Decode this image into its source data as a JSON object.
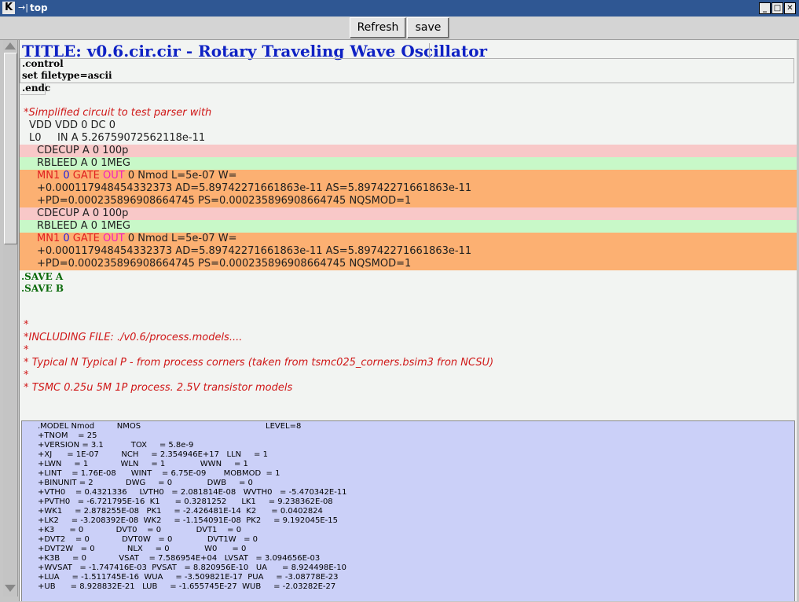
{
  "window": {
    "app_icon": "K",
    "title": "top",
    "pin_glyph": "→|",
    "minimize": "_",
    "maximize": "□",
    "close": "✕"
  },
  "toolbar": {
    "refresh_label": "Refresh",
    "save_label": "save"
  },
  "doc": {
    "title": "TITLE: v0.6.cir.cir - Rotary Traveling Wave Oscillator",
    "control": [
      ".control",
      "set filetype=ascii",
      ".endc"
    ],
    "comment1": "*Simplified circuit to test parser with",
    "vdd": "VDD VDD 0 DC 0",
    "l0_name": "L0",
    "l0_rest": "IN A 5.26759072562118e-11",
    "blocks": [
      {
        "cdecup": "CDECUP A 0 100p",
        "rbleed": "RBLEED A 0 1MEG",
        "mn1": {
          "name": "MN1",
          "n0": "0",
          "gate": "GATE",
          "out": "OUT",
          "rest": "0 Nmod L=5e-07 W="
        },
        "cont1": "+0.000117948454332373 AD=5.89742271661863e-11 AS=5.89742271661863e-11",
        "cont2": "+PD=0.000235896908664745 PS=0.000235896908664745 NQSMOD=1"
      },
      {
        "cdecup": "CDECUP A 0 100p",
        "rbleed": "RBLEED A 0 1MEG",
        "mn1": {
          "name": "MN1",
          "n0": "0",
          "gate": "GATE",
          "out": "OUT",
          "rest": "0 Nmod L=5e-07 W="
        },
        "cont1": "+0.000117948454332373 AD=5.89742271661863e-11 AS=5.89742271661863e-11",
        "cont2": "+PD=0.000235896908664745 PS=0.000235896908664745 NQSMOD=1"
      }
    ],
    "saves": [
      ".SAVE A",
      ".SAVE B"
    ],
    "include_comments": [
      "*",
      "*INCLUDING FILE: ./v0.6/process.models....",
      "*",
      "* Typical N Typical P    - from process corners  (taken from tsmc025_corners.bsim3 fron NCSU)",
      "*",
      "* TSMC 0.25u 5M 1P process.  2.5V transistor models"
    ],
    "model_lines": [
      ".MODEL Nmod         NMOS                                                  LEVEL=8",
      "+TNOM    = 25",
      "+VERSION = 3.1           TOX     = 5.8e-9",
      "+XJ      = 1E-07         NCH     = 2.354946E+17   LLN     = 1",
      "+LWN     = 1             WLN     = 1              WWN     = 1",
      "+LINT    = 1.76E-08      WINT    = 6.75E-09       MOBMOD  = 1",
      "+BINUNIT = 2             DWG     = 0              DWB     = 0",
      "+VTH0    = 0.4321336     LVTH0   = 2.081814E-08   WVTH0   = -5.470342E-11",
      "+PVTH0   = -6.721795E-16  K1      = 0.3281252      LK1     = 9.238362E-08",
      "+WK1     = 2.878255E-08   PK1     = -2.426481E-14  K2      = 0.0402824",
      "+LK2     = -3.208392E-08  WK2     = -1.154091E-08  PK2     = 9.192045E-15",
      "+K3      = 0             DVT0    = 0              DVT1    = 0",
      "+DVT2    = 0             DVT0W   = 0              DVT1W   = 0",
      "+DVT2W   = 0             NLX     = 0              W0      = 0",
      "+K3B     = 0             VSAT    = 7.586954E+04   LVSAT   = 3.094656E-03",
      "+WVSAT   = -1.747416E-03  PVSAT   = 8.820956E-10   UA      = 8.924498E-10",
      "+LUA     = -1.511745E-16  WUA     = -3.509821E-17  PUA     = -3.08778E-23",
      "+UB      = 8.928832E-21   LUB     = -1.655745E-27  WUB     = -2.03282E-27"
    ]
  },
  "colors": {
    "titlebar": "#2f5793",
    "title_text": "#0f22c4",
    "comment_red": "#d01818",
    "cdecup_bg": "#f8c8c8",
    "rbleed_bg": "#c8f8c8",
    "mn1_bg": "#fcb072",
    "model_bg": "#cbd0f8",
    "save_green": "#0a6a0a"
  }
}
